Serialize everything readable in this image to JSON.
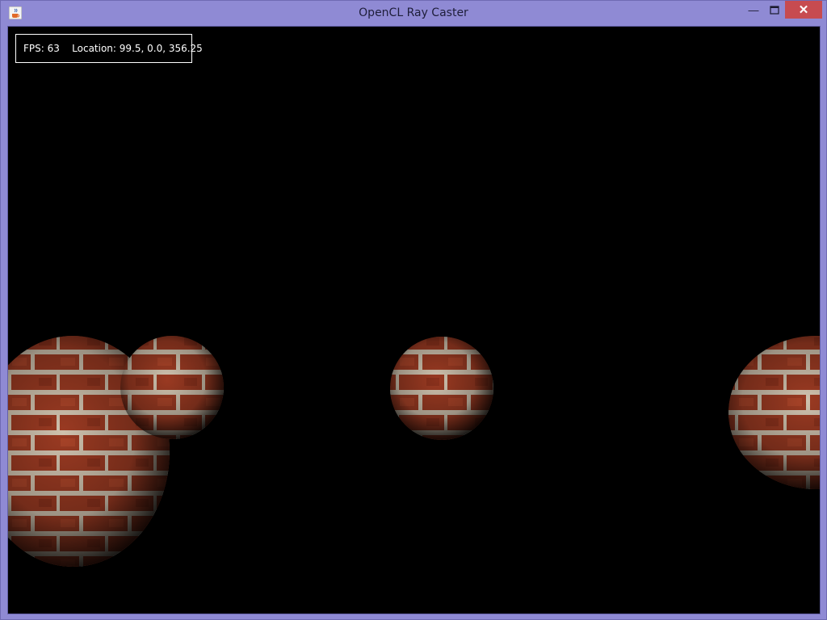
{
  "window": {
    "title": "OpenCL Ray Caster",
    "app_icon": "java-cup-icon",
    "controls": {
      "minimize_icon": "minimize-icon",
      "maximize_icon": "maximize-icon",
      "close_icon": "close-icon",
      "close_color": "#c74b50"
    },
    "frame_color": "#8f8ad4"
  },
  "hud": {
    "fps_label": "FPS: 63",
    "location_label": "Location: 99.5, 0.0, 356.25"
  },
  "scene": {
    "background": "#000000",
    "objects": [
      "brick-sphere",
      "brick-sphere",
      "brick-sphere",
      "brick-sphere"
    ]
  }
}
